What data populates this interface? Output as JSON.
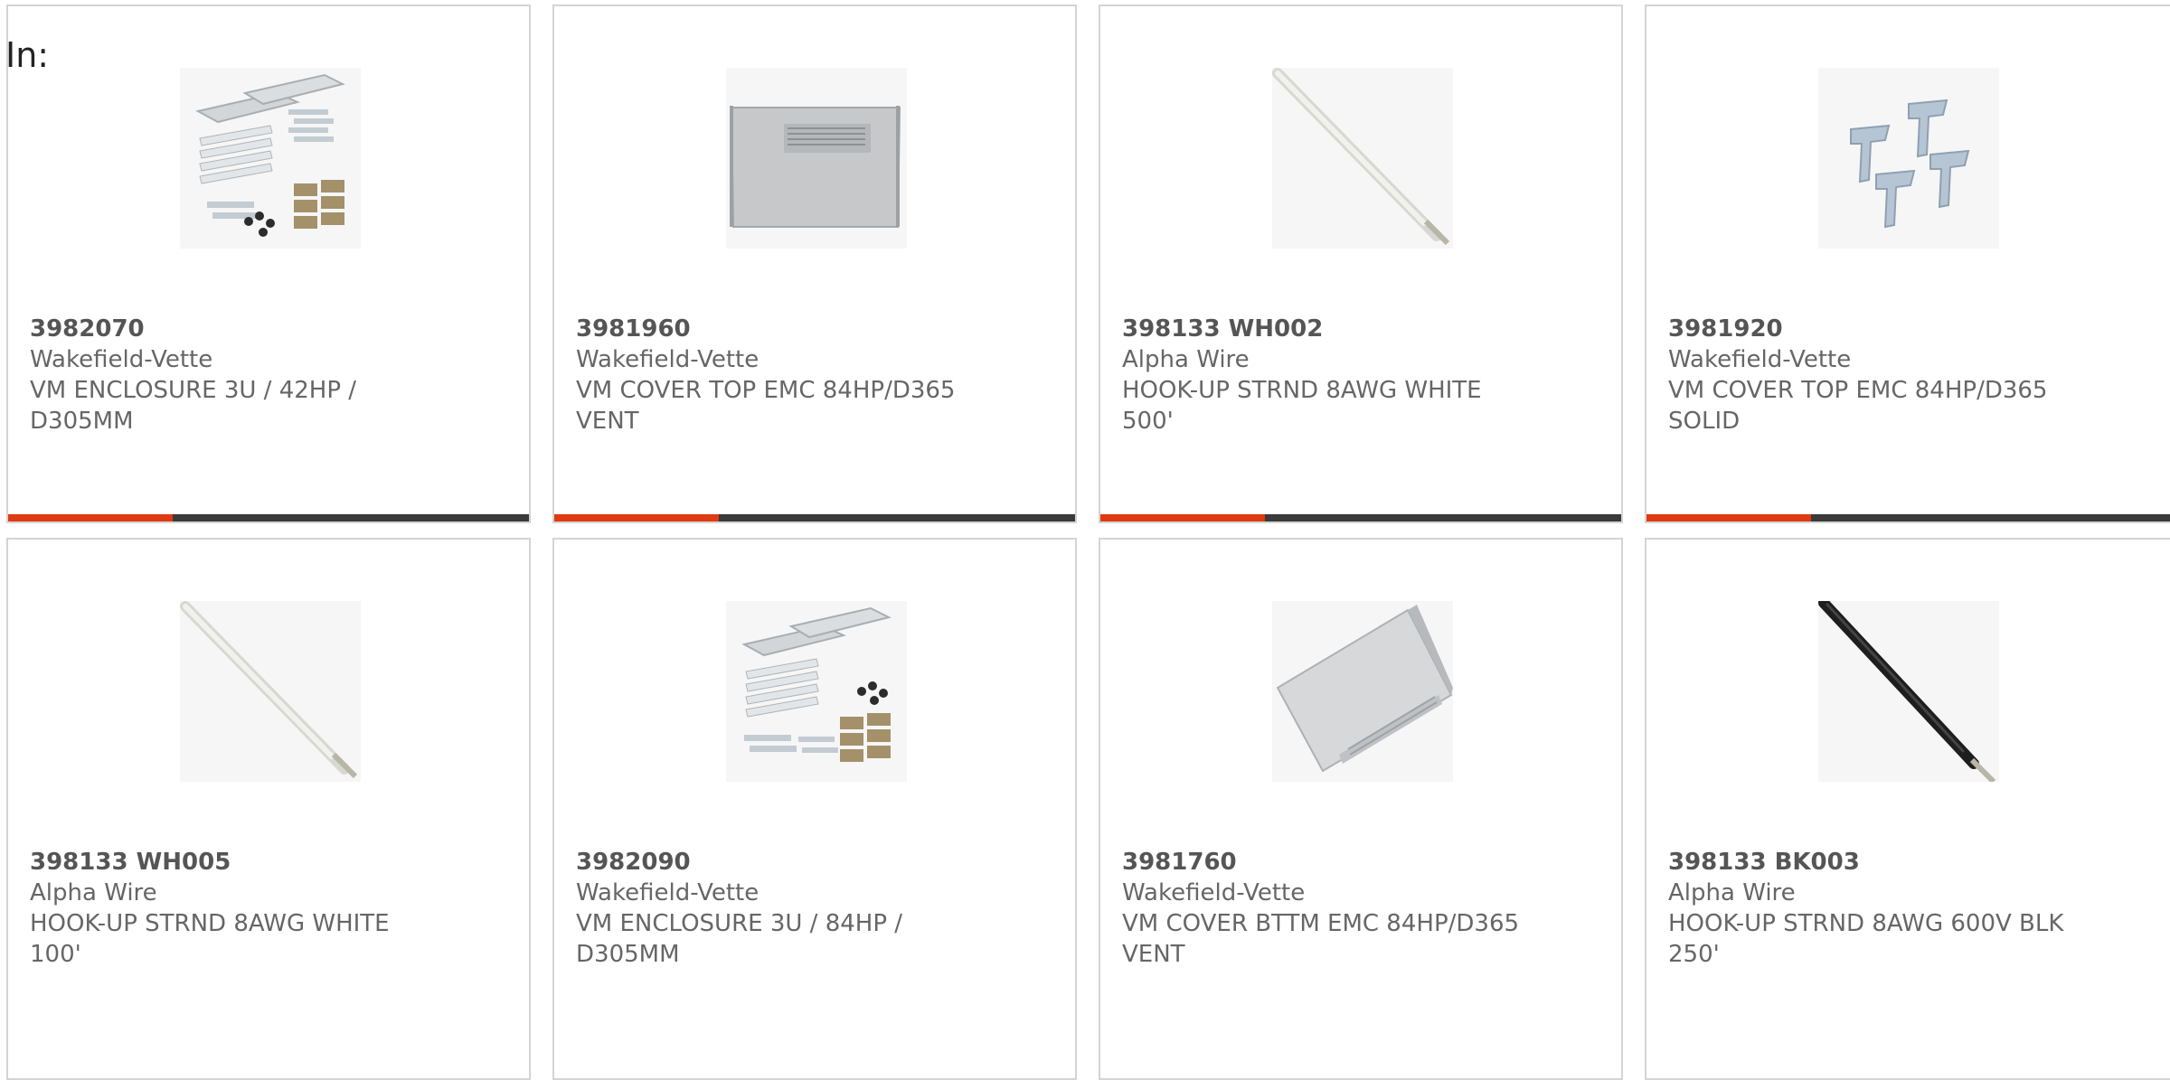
{
  "filter": {
    "in_label": "In:"
  },
  "accent_color": "#e03a12",
  "bar_color": "#3a3a3a",
  "products": [
    {
      "pn": "3982070",
      "mfr": "Wakefield-Vette",
      "desc": "VM ENCLOSURE 3U / 42HP / D305MM",
      "image": "enclosure-kit"
    },
    {
      "pn": "3981960",
      "mfr": "Wakefield-Vette",
      "desc": "VM COVER TOP EMC 84HP/D365 VENT",
      "image": "cover-vent"
    },
    {
      "pn": "398133 WH002",
      "mfr": "Alpha Wire",
      "desc": "HOOK-UP STRND 8AWG WHITE 500'",
      "image": "wire-white"
    },
    {
      "pn": "3981920",
      "mfr": "Wakefield-Vette",
      "desc": "VM COVER TOP EMC 84HP/D365 SOLID",
      "image": "brackets"
    },
    {
      "pn": "398133 WH005",
      "mfr": "Alpha Wire",
      "desc": "HOOK-UP STRND 8AWG WHITE 100'",
      "image": "wire-white"
    },
    {
      "pn": "3982090",
      "mfr": "Wakefield-Vette",
      "desc": "VM ENCLOSURE 3U / 84HP / D305MM",
      "image": "enclosure-kit"
    },
    {
      "pn": "3981760",
      "mfr": "Wakefield-Vette",
      "desc": "VM COVER BTTM EMC 84HP/D365 VENT",
      "image": "cover-tilted"
    },
    {
      "pn": "398133 BK003",
      "mfr": "Alpha Wire",
      "desc": "HOOK-UP STRND 8AWG 600V BLK 250'",
      "image": "wire-black"
    }
  ]
}
